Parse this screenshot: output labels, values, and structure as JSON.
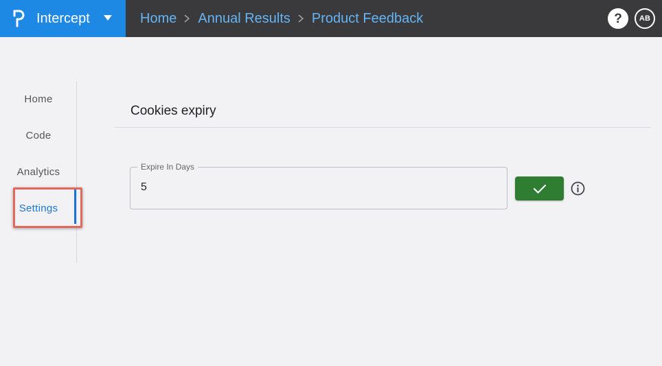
{
  "header": {
    "app_name": "Intercept",
    "breadcrumbs": [
      "Home",
      "Annual Results",
      "Product Feedback :"
    ],
    "help_symbol": "?",
    "user_initials": "AB",
    "colors": {
      "brand": "#1e88e5",
      "bar": "#3a3a3c",
      "link": "#64b5f6"
    }
  },
  "sidebar": {
    "items": [
      {
        "label": "Home"
      },
      {
        "label": "Code"
      },
      {
        "label": "Analytics"
      },
      {
        "label": "Settings",
        "active": true
      }
    ]
  },
  "main": {
    "section_title": "Cookies expiry",
    "expire_field": {
      "label": "Expire In Days",
      "value": "5"
    },
    "confirm_icon": "check-icon",
    "info_icon": "info-icon",
    "colors": {
      "confirm": "#2e7d32",
      "accent": "#1976d2",
      "highlight": "#e2685a"
    }
  }
}
